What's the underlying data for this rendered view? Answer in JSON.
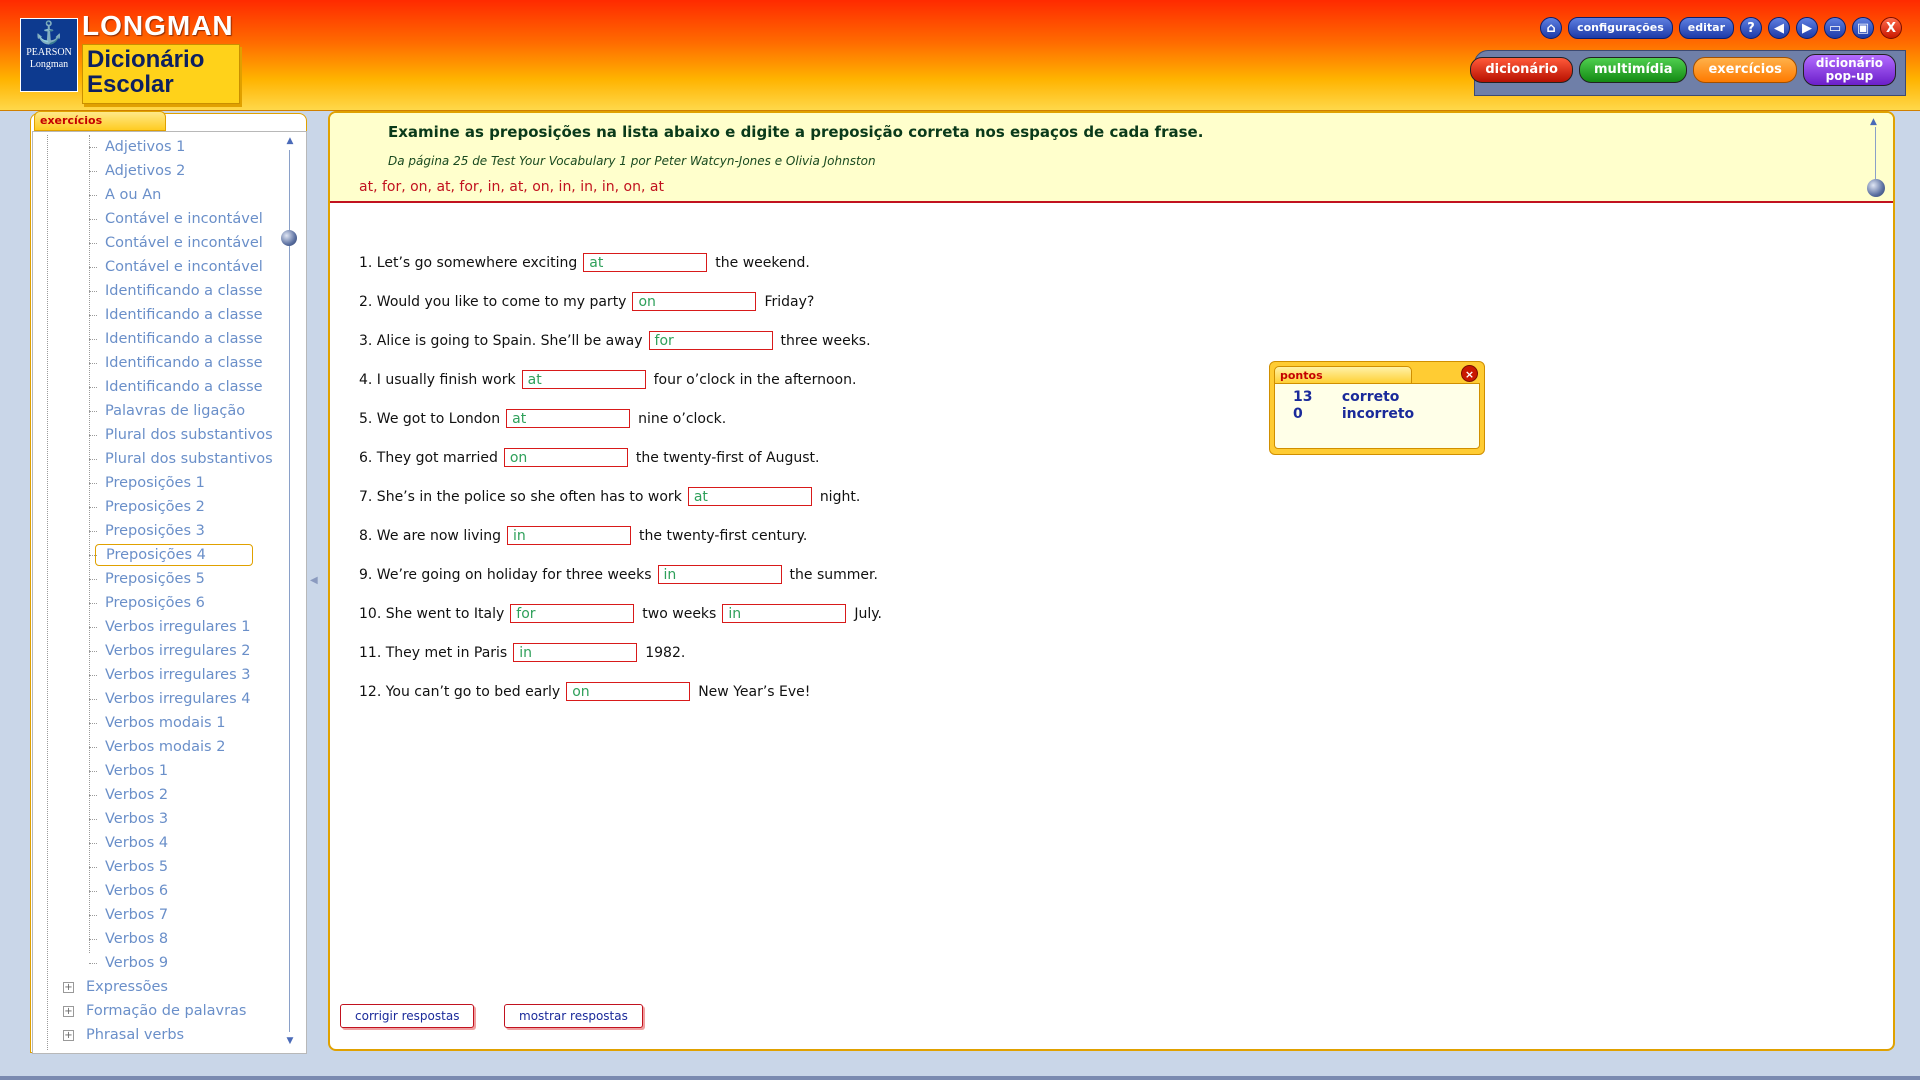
{
  "brand": {
    "publisher_top": "PEARSON",
    "publisher_bottom": "Longman",
    "title": "LONGMAN",
    "subtitle": "Dicionário Escolar"
  },
  "toolbar": {
    "configuracoes": "configurações",
    "editar": "editar",
    "help": "?",
    "back": "◀",
    "forward": "▶",
    "close": "X"
  },
  "tabs": {
    "dicionario": "dicionário",
    "multimidia": "multimídia",
    "exercicios": "exercícios",
    "popup_line1": "dicionário",
    "popup_line2": "pop-up"
  },
  "sidebar": {
    "tab_label": "exercícios",
    "items": [
      "Adjetivos 1",
      "Adjetivos 2",
      "A ou An",
      "Contável e incontável",
      "Contável e incontável",
      "Contável e incontável",
      "Identificando a classe",
      "Identificando a classe",
      "Identificando a classe",
      "Identificando a classe",
      "Identificando a classe",
      "Palavras de ligação",
      "Plural dos substantivos",
      "Plural dos substantivos",
      "Preposições 1",
      "Preposições 2",
      "Preposições 3",
      "Preposições 4",
      "Preposições 5",
      "Preposições 6",
      "Verbos irregulares 1",
      "Verbos irregulares 2",
      "Verbos irregulares 3",
      "Verbos irregulares 4",
      "Verbos modais 1",
      "Verbos modais 2",
      "Verbos 1",
      "Verbos 2",
      "Verbos 3",
      "Verbos 4",
      "Verbos 5",
      "Verbos 6",
      "Verbos 7",
      "Verbos 8",
      "Verbos 9"
    ],
    "groups": [
      "Expressões",
      "Formação de palavras",
      "Phrasal verbs"
    ],
    "selected_index": 17
  },
  "exercise": {
    "instruction": "Examine as preposições na lista abaixo e digite a preposição correta nos espaços de cada frase.",
    "source": "Da página 25 de Test Your Vocabulary 1 por Peter Watcyn-Jones e Olivia Johnston",
    "word_list": "at, for, on, at, for, in, at, on, in, in, in, on, at",
    "questions": [
      {
        "before": "1. Let’s go somewhere exciting",
        "answer": "at",
        "after": "the weekend."
      },
      {
        "before": "2. Would you like to come to my party",
        "answer": "on",
        "after": "Friday?"
      },
      {
        "before": "3. Alice is going to Spain. She’ll be away",
        "answer": "for",
        "after": "three weeks."
      },
      {
        "before": "4. I usually finish work",
        "answer": "at",
        "after": "four o’clock in the afternoon."
      },
      {
        "before": "5. We got to London",
        "answer": "at",
        "after": "nine o’clock."
      },
      {
        "before": "6. They got married",
        "answer": "on",
        "after": "the twenty-first of August."
      },
      {
        "before": "7. She’s in the police so she often has to work",
        "answer": "at",
        "after": "night."
      },
      {
        "before": "8. We are now living",
        "answer": "in",
        "after": "the twenty-first century."
      },
      {
        "before": "9. We’re going on holiday for three weeks",
        "answer": "in",
        "after": "the summer."
      },
      {
        "before": "10. She went to Italy",
        "answer": "for",
        "middle": "two weeks",
        "answer2": "in",
        "after": "July."
      },
      {
        "before": "11. They met in Paris",
        "answer": "in",
        "after": "1982."
      },
      {
        "before": "12. You can’t go to bed early",
        "answer": "on",
        "after": "New Year’s Eve!"
      }
    ],
    "check_label": "corrigir respostas",
    "show_label": "mostrar respostas"
  },
  "score": {
    "title": "pontos",
    "correct_count": "13",
    "correct_label": "correto",
    "incorrect_count": "0",
    "incorrect_label": "incorreto"
  },
  "colors": {
    "accent": "#e0a100",
    "answer_border": "#d81a1a",
    "answer_text": "#2ea05a",
    "link_blue": "#6a8fc9"
  }
}
